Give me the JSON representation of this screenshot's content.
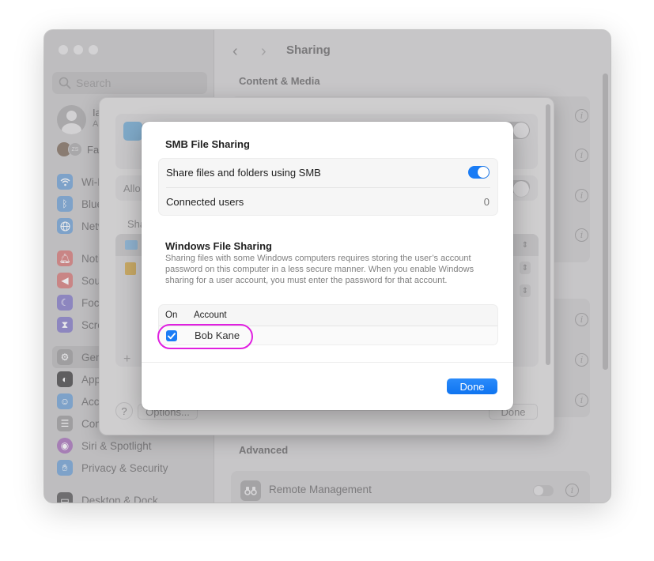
{
  "window": {
    "sidebar": {
      "search_placeholder": "Search",
      "profile": {
        "name": "Ia",
        "subtitle": "A"
      },
      "family": {
        "initials": "ZS",
        "label": "Fa"
      },
      "items": [
        {
          "label": "Wi-Fi",
          "icon": "wifi-icon",
          "color": "#7ea2c9"
        },
        {
          "label": "Bluetooth",
          "icon": "bluetooth-icon",
          "color": "#7ea2c9"
        },
        {
          "label": "Network",
          "icon": "globe-icon",
          "color": "#7ea2c9"
        },
        {
          "label": "Notifications",
          "icon": "bell-icon",
          "color": "#c98585"
        },
        {
          "label": "Sound",
          "icon": "speaker-icon",
          "color": "#c98585"
        },
        {
          "label": "Focus",
          "icon": "moon-icon",
          "color": "#8d86bf"
        },
        {
          "label": "Screen Time",
          "icon": "hourglass-icon",
          "color": "#8d86bf"
        },
        {
          "label": "General",
          "icon": "gear-icon",
          "color": "#9f9ea0",
          "selected": true
        },
        {
          "label": "Appearance",
          "icon": "appearance-icon",
          "color": "#5f5e60"
        },
        {
          "label": "Accessibility",
          "icon": "accessibility-icon",
          "color": "#7ea2c9"
        },
        {
          "label": "Control Center",
          "icon": "control-center-icon",
          "color": "#9f9ea0"
        },
        {
          "label": "Siri & Spotlight",
          "icon": "siri-icon",
          "color": "#a67eb5"
        },
        {
          "label": "Privacy & Security",
          "icon": "hand-icon",
          "color": "#7ea2c9"
        },
        {
          "label": "Desktop & Dock",
          "icon": "dock-icon",
          "color": "#6f6e70"
        }
      ]
    },
    "content": {
      "nav_back": "‹",
      "nav_forward": "›",
      "title": "Sharing",
      "section_content_media": "Content & Media",
      "section_advanced": "Advanced",
      "remote_management_label": "Remote Management",
      "remote_management_on": false
    }
  },
  "file_sharing_sheet": {
    "allow_label": "Allo",
    "shared_label": "Sha",
    "plus_label": "+",
    "help_label": "?",
    "options_label": "Options...",
    "done_label": "Done"
  },
  "smb_dialog": {
    "title": "SMB File Sharing",
    "share_label": "Share files and folders using SMB",
    "share_enabled": true,
    "connected_users_label": "Connected users",
    "connected_users_value": "0",
    "windows_title": "Windows File Sharing",
    "windows_description": "Sharing files with some Windows computers requires storing the user’s account password on this computer in a less secure manner. When you enable Windows sharing for a user account, you must enter the password for that account.",
    "table": {
      "headers": {
        "on": "On",
        "account": "Account"
      },
      "rows": [
        {
          "on": true,
          "account": "Bob Kane"
        }
      ]
    },
    "done_label": "Done",
    "accent_color": "#1a7cf5",
    "highlight_color": "#e020e0"
  }
}
